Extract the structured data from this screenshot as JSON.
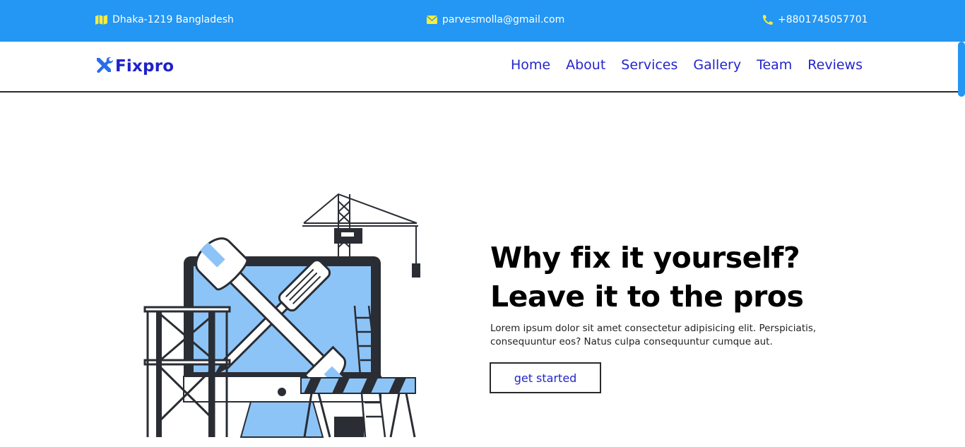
{
  "topbar": {
    "address": "Dhaka-1219 Bangladesh",
    "email": "parvesmolla@gmail.com",
    "phone": "+8801745057701",
    "icon_color": "#f9ec3b",
    "background": "#2496f3"
  },
  "nav": {
    "logo_text": "Fixpro",
    "links": [
      "Home",
      "About",
      "Services",
      "Gallery",
      "Team",
      "Reviews"
    ],
    "link_color": "#2425cc"
  },
  "hero": {
    "headline_line1": "Why fix it yourself?",
    "headline_line2": "Leave it to the pros",
    "body": "Lorem ipsum dolor sit amet consectetur adipisicing elit. Perspiciatis, consequuntur eos? Natus culpa consequuntur cumque aut.",
    "cta_label": "get started"
  },
  "icons": {
    "address": "map-icon",
    "email": "envelope-icon",
    "phone": "phone-icon",
    "logo": "tools-icon"
  }
}
